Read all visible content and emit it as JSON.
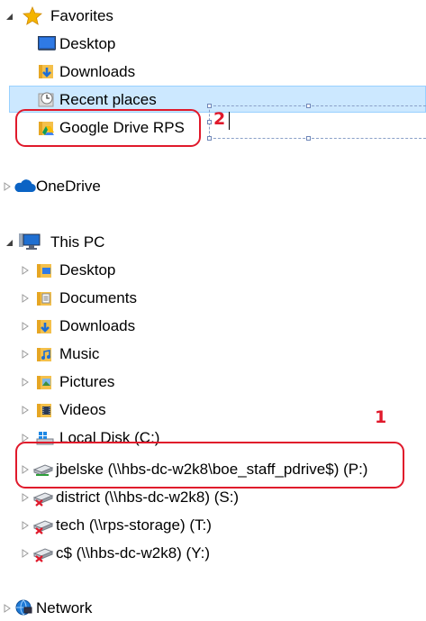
{
  "tree": {
    "favorites": {
      "label": "Favorites",
      "items": [
        {
          "label": "Desktop",
          "icon": "desktop-icon"
        },
        {
          "label": "Downloads",
          "icon": "downloads-icon"
        },
        {
          "label": "Recent places",
          "icon": "recent-places-icon"
        },
        {
          "label": "Google Drive RPS",
          "icon": "google-drive-folder-icon"
        }
      ]
    },
    "onedrive": {
      "label": "OneDrive",
      "icon": "onedrive-icon"
    },
    "this_pc": {
      "label": "This PC",
      "items": [
        {
          "label": "Desktop",
          "icon": "desktop-folder-icon"
        },
        {
          "label": "Documents",
          "icon": "documents-folder-icon"
        },
        {
          "label": "Downloads",
          "icon": "downloads-folder-icon"
        },
        {
          "label": "Music",
          "icon": "music-folder-icon"
        },
        {
          "label": "Pictures",
          "icon": "pictures-folder-icon"
        },
        {
          "label": "Videos",
          "icon": "videos-folder-icon"
        },
        {
          "label": "Local Disk (C:)",
          "icon": "local-disk-icon"
        },
        {
          "label": "jbelske (\\\\hbs-dc-w2k8\\boe_staff_pdrive$) (P:)",
          "icon": "network-drive-icon"
        },
        {
          "label": "district (\\\\hbs-dc-w2k8) (S:)",
          "icon": "disconnected-network-drive-icon"
        },
        {
          "label": "tech (\\\\rps-storage) (T:)",
          "icon": "disconnected-network-drive-icon"
        },
        {
          "label": "c$ (\\\\hbs-dc-w2k8) (Y:)",
          "icon": "disconnected-network-drive-icon"
        }
      ]
    },
    "network": {
      "label": "Network",
      "icon": "network-icon"
    }
  },
  "annotations": {
    "one": "1",
    "two": "2"
  },
  "colors": {
    "selection": "#cce8ff",
    "annotation": "#e0192b",
    "folder": "#f4c04b"
  }
}
